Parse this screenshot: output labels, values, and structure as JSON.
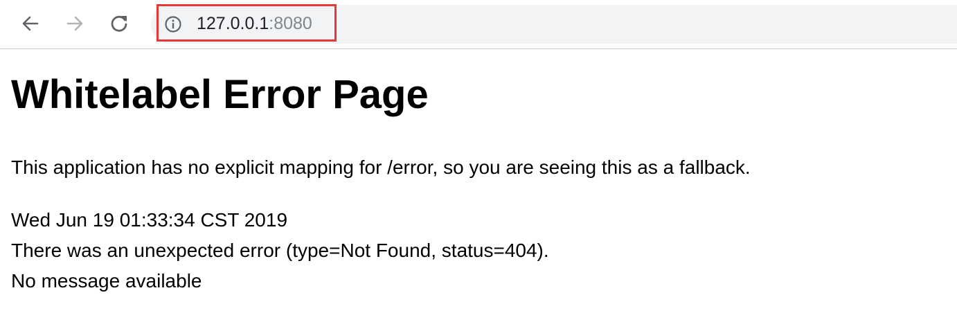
{
  "browser": {
    "nav_icons": {
      "back": "arrow-left-icon",
      "forward": "arrow-right-icon",
      "reload": "reload-icon",
      "site_info": "info-circle-icon"
    },
    "forward_enabled": false,
    "address": {
      "host": "127.0.0.1",
      "port": ":8080"
    },
    "highlight_color": "#e53935"
  },
  "page": {
    "title": "Whitelabel Error Page",
    "description": "This application has no explicit mapping for /error, so you are seeing this as a fallback.",
    "timestamp": "Wed Jun 19 01:33:34 CST 2019",
    "error_line": "There was an unexpected error (type=Not Found, status=404).",
    "message": "No message available"
  }
}
